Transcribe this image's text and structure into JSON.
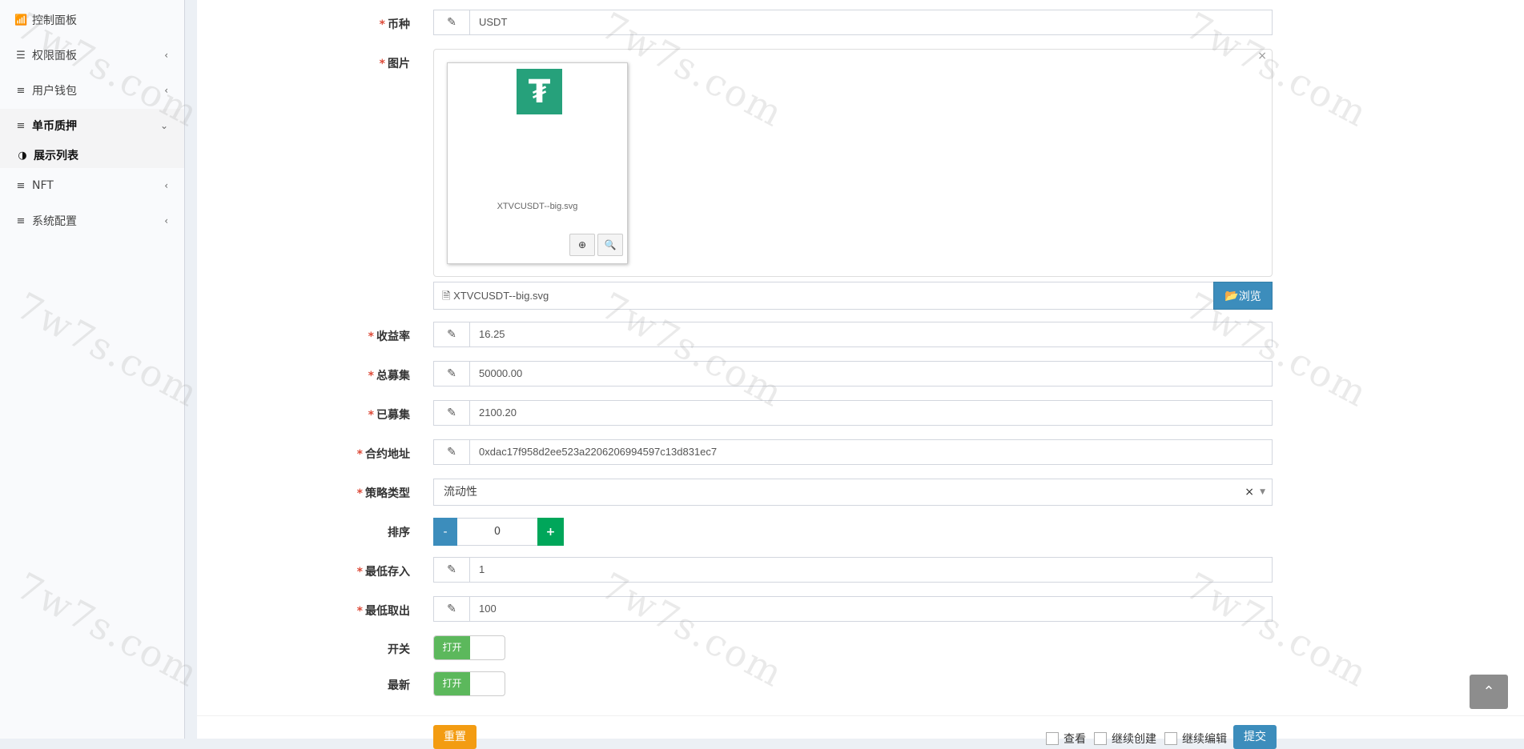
{
  "sidebar": {
    "items": [
      {
        "label": "控制面板",
        "icon": "bar-chart-icon",
        "chevron": ""
      },
      {
        "label": "权限面板",
        "icon": "list-icon",
        "chevron": "‹"
      },
      {
        "label": "用户钱包",
        "icon": "align-left-icon",
        "chevron": "‹"
      },
      {
        "label": "单币质押",
        "icon": "align-left-icon",
        "chevron": "⌄"
      },
      {
        "label": "展示列表",
        "icon": "adjust-icon",
        "chevron": ""
      },
      {
        "label": "NFT",
        "icon": "align-left-icon",
        "chevron": "‹"
      },
      {
        "label": "系统配置",
        "icon": "align-left-icon",
        "chevron": "‹"
      }
    ]
  },
  "form": {
    "required_mark": "*",
    "currency": {
      "label": "币种",
      "value": "USDT"
    },
    "image": {
      "label": "图片",
      "thumb_caption": "XTVCUSDT--big.svg",
      "file_name": "XTVCUSDT--big.svg",
      "browse_label": "浏览",
      "close": "×",
      "logo_glyph": "₮"
    },
    "yield_rate": {
      "label": "收益率",
      "value": "16.25"
    },
    "total_raise": {
      "label": "总募集",
      "value": "50000.00"
    },
    "raised": {
      "label": "已募集",
      "value": "2100.20"
    },
    "contract": {
      "label": "合约地址",
      "value": "0xdac17f958d2ee523a2206206994597c13d831ec7"
    },
    "strategy": {
      "label": "策略类型",
      "value": "流动性",
      "clear": "×",
      "arrow": "▼"
    },
    "sort": {
      "label": "排序",
      "value": "0",
      "minus": "-",
      "plus": "+"
    },
    "min_deposit": {
      "label": "最低存入",
      "value": "1"
    },
    "min_withdraw": {
      "label": "最低取出",
      "value": "100"
    },
    "switch_on": {
      "label": "开关",
      "state": "打开"
    },
    "newest": {
      "label": "最新",
      "state": "打开"
    }
  },
  "footer": {
    "reset": "重置",
    "view": "查看",
    "continue_create": "继续创建",
    "continue_edit": "继续编辑",
    "submit": "提交"
  },
  "watermark": "7w7s.com",
  "colors": {
    "primary": "#3c8dbc",
    "success": "#00a65a",
    "warning": "#f39c12",
    "switch_on": "#5cb85c",
    "required": "#dd4b39",
    "tether": "#26a17b"
  }
}
